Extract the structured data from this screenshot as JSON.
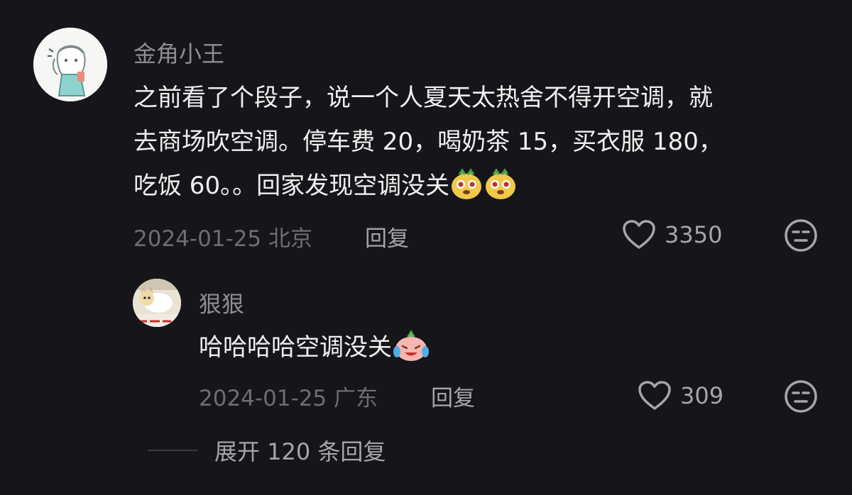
{
  "colors": {
    "background": "#161519",
    "text_primary": "#f0f0f0",
    "text_secondary": "#8e8d92",
    "text_meta": "#6e6d73"
  },
  "comment": {
    "username": "金角小王",
    "text_lines": [
      "之前看了个段子，说一个人夏天太热舍不得开空调，就",
      "去商场吹空调。停车费 20，喝奶茶 15，买衣服 180，",
      "吃饭 60。。回家发现空调没关"
    ],
    "emojis": [
      "dog-face-emoji",
      "dog-face-emoji"
    ],
    "date": "2024-01-25",
    "location": "北京",
    "reply_label": "回复",
    "like_count": "3350",
    "like_icon": "heart-icon",
    "react_icon": "unamused-face-icon"
  },
  "reply": {
    "username": "狠狠",
    "text": "哈哈哈哈空调没关",
    "emoji": "crying-laughing-emoji",
    "date": "2024-01-25",
    "location": "广东",
    "reply_label": "回复",
    "like_count": "309",
    "like_icon": "heart-icon",
    "react_icon": "unamused-face-icon"
  },
  "expand": {
    "label": "展开 120 条回复"
  }
}
